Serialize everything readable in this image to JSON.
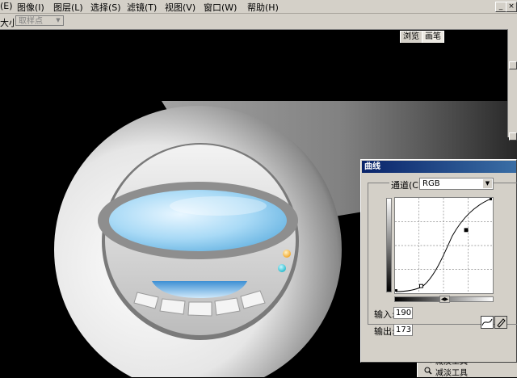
{
  "menubar": {
    "items": [
      "(E)",
      "图像(I)",
      "图层(L)",
      "选择(S)",
      "滤镜(T)",
      "视图(V)",
      "窗口(W)",
      "帮助(H)"
    ],
    "window_controls": [
      "_",
      "×"
    ]
  },
  "options": {
    "label": "大小:",
    "sample_value": "取样点"
  },
  "palette": {
    "tabs": [
      "浏览",
      "画笔"
    ]
  },
  "curves": {
    "title": "曲线",
    "channel_label": "通道(C):",
    "channel_value": "RGB",
    "input_label": "输入:",
    "input_value": "190",
    "output_label": "输出:",
    "output_value": "173"
  },
  "toolbox": {
    "items": [
      "减淡工具",
      "减淡工具"
    ]
  },
  "colors": {
    "dialog_bg": "#d4d0c8",
    "titlebar": "#0a246a",
    "lens_blue": "#9fd3f2",
    "amber_led": "#f2a21c",
    "teal_led": "#1cb7c9"
  }
}
